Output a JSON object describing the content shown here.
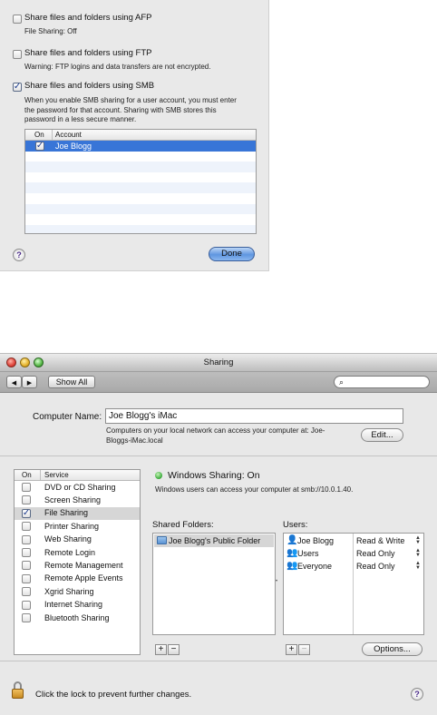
{
  "sheet": {
    "afp": {
      "label": "Share files and folders using AFP",
      "note": "File Sharing: Off",
      "checked": false
    },
    "ftp": {
      "label": "Share files and folders using FTP",
      "note": "Warning: FTP logins and data transfers are not encrypted.",
      "checked": false
    },
    "smb": {
      "label": "Share files and folders using SMB",
      "note_lines": [
        "When you enable SMB sharing for a user account, you must enter",
        "the password for that account. Sharing with SMB stores this",
        "password in a less secure manner."
      ],
      "checked": true
    },
    "accounts_table": {
      "col_on": "On",
      "col_account": "Account",
      "rows": [
        {
          "name": "Joe Blogg",
          "checked": true
        }
      ]
    },
    "help": "?",
    "done_label": "Done"
  },
  "window": {
    "title": "Sharing",
    "toolbar": {
      "back": "◀",
      "forward": "▶",
      "show_all": "Show All",
      "search_placeholder": ""
    },
    "computer_name": {
      "label": "Computer Name:",
      "value": "Joe Blogg's iMac",
      "note_lines": [
        "Computers on your local network can access your computer at: Joe-",
        "Bloggs-iMac.local"
      ],
      "edit_label": "Edit..."
    },
    "services": {
      "col_on": "On",
      "col_service": "Service",
      "items": [
        {
          "label": "DVD or CD Sharing",
          "checked": false
        },
        {
          "label": "Screen Sharing",
          "checked": false
        },
        {
          "label": "File Sharing",
          "checked": true
        },
        {
          "label": "Printer Sharing",
          "checked": false
        },
        {
          "label": "Web Sharing",
          "checked": false
        },
        {
          "label": "Remote Login",
          "checked": false
        },
        {
          "label": "Remote Management",
          "checked": false
        },
        {
          "label": "Remote Apple Events",
          "checked": false
        },
        {
          "label": "Xgrid Sharing",
          "checked": false
        },
        {
          "label": "Internet Sharing",
          "checked": false
        },
        {
          "label": "Bluetooth Sharing",
          "checked": false
        }
      ]
    },
    "status": {
      "text": "Windows Sharing: On",
      "detail": "Windows users can access your computer at smb://10.0.1.40.",
      "color": "#3fae3f"
    },
    "shared_folders": {
      "label": "Shared Folders:",
      "items": [
        "Joe Blogg's Public Folder"
      ]
    },
    "users": {
      "label": "Users:",
      "items": [
        {
          "name": "Joe Blogg",
          "access": "Read & Write"
        },
        {
          "name": "Users",
          "access": "Read Only"
        },
        {
          "name": "Everyone",
          "access": "Read Only"
        }
      ]
    },
    "add_label": "+",
    "remove_label": "−",
    "options_label": "Options...",
    "lock_text": "Click the lock to prevent further changes.",
    "help": "?"
  }
}
